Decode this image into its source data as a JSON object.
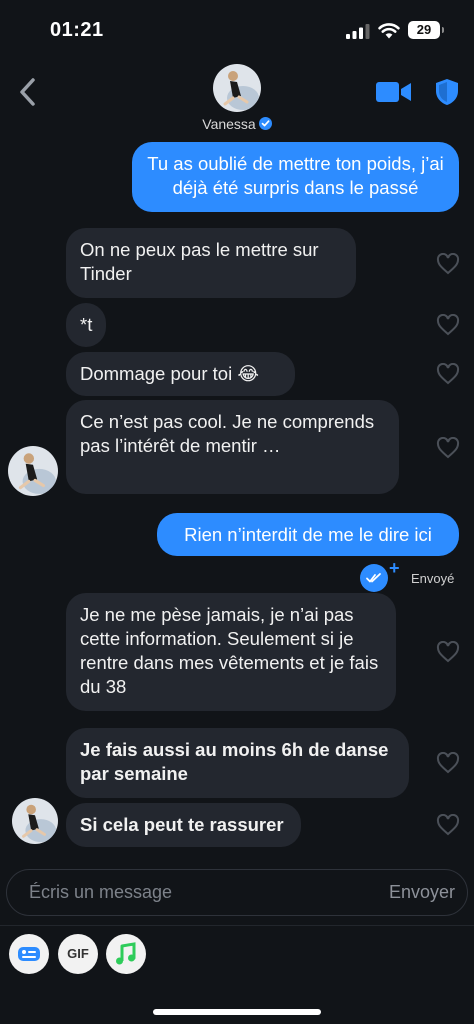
{
  "status_bar": {
    "time": "01:21",
    "battery": "29"
  },
  "header": {
    "contact_name": "Vanessa"
  },
  "messages": [
    {
      "direction": "out",
      "text": "Tu as oublié de mettre ton poids, j’ai déjà été surpris dans le passé"
    },
    {
      "direction": "in",
      "text": "On ne peux pas le mettre sur Tinder"
    },
    {
      "direction": "in",
      "text": "*t"
    },
    {
      "direction": "in",
      "text": "Dommage pour toi 😂"
    },
    {
      "direction": "in",
      "text": "Ce n’est pas cool. Je ne comprends pas l’intérêt de mentir …"
    },
    {
      "direction": "out",
      "text": "Rien n’interdit de me le dire ici"
    },
    {
      "direction": "in",
      "text": "Je ne me pèse jamais, je n’ai pas cette information. Seulement si je rentre dans mes vêtements et je fais du 38"
    },
    {
      "direction": "in",
      "text": "Je fais aussi au moins 6h de danse par semaine"
    },
    {
      "direction": "in",
      "text": "Si cela peut te rassurer"
    }
  ],
  "delivery_status": "Envoyé",
  "composer": {
    "placeholder": "Écris un message",
    "send_label": "Envoyer"
  },
  "toolbar": {
    "gif_label": "GIF"
  },
  "colors": {
    "accent": "#2d8cff",
    "incoming_bubble": "#23272f",
    "background": "#111418"
  },
  "icons": [
    "back-chevron-icon",
    "video-camera-icon",
    "shield-icon",
    "verified-badge-icon",
    "heart-icon",
    "double-check-icon",
    "plus-icon",
    "sticker-icon",
    "music-note-icon"
  ]
}
